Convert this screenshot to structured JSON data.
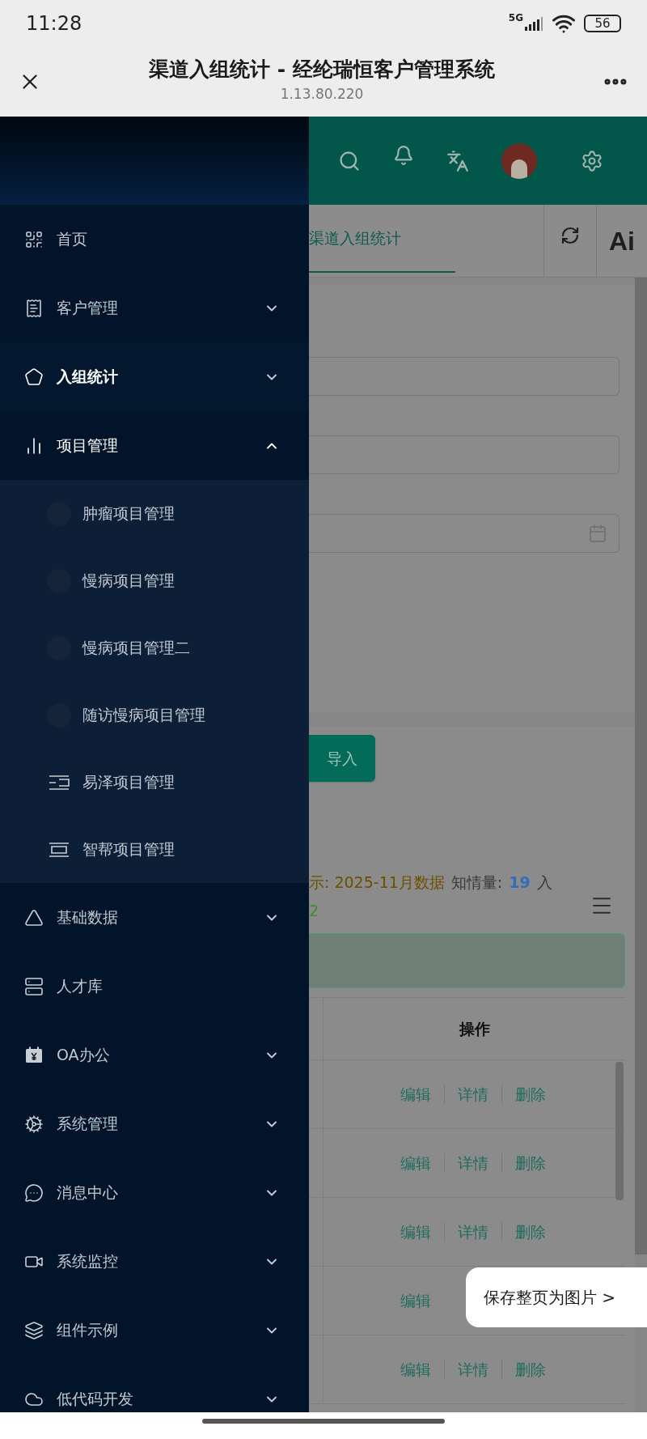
{
  "status_bar": {
    "time": "11:28",
    "network": "5G",
    "battery": "56"
  },
  "title_bar": {
    "title": "渠道入组统计 - 经纶瑞恒客户管理系统",
    "url": "1.13.80.220"
  },
  "sidebar": {
    "items": [
      {
        "label": "首页",
        "kind": "link",
        "selected": false
      },
      {
        "label": "客户管理",
        "kind": "group",
        "selected": false,
        "expanded": false
      },
      {
        "label": "入组统计",
        "kind": "group",
        "selected": true,
        "expanded": false
      },
      {
        "label": "项目管理",
        "kind": "group",
        "selected": false,
        "expanded": true,
        "children": [
          {
            "label": "肿瘤项目管理",
            "selected": false
          },
          {
            "label": "慢病项目管理",
            "selected": false
          },
          {
            "label": "慢病项目管理二",
            "selected": false
          },
          {
            "label": "随访慢病项目管理",
            "selected": false
          },
          {
            "label": "易泽项目管理",
            "selected": false
          },
          {
            "label": "智帮项目管理",
            "selected": false
          }
        ]
      },
      {
        "label": "基础数据",
        "kind": "group",
        "selected": false,
        "expanded": false
      },
      {
        "label": "人才库",
        "kind": "link",
        "selected": false
      },
      {
        "label": "OA办公",
        "kind": "group",
        "selected": false,
        "expanded": false
      },
      {
        "label": "系统管理",
        "kind": "group",
        "selected": false,
        "expanded": false
      },
      {
        "label": "消息中心",
        "kind": "group",
        "selected": false,
        "expanded": false
      },
      {
        "label": "系统监控",
        "kind": "group",
        "selected": false,
        "expanded": false
      },
      {
        "label": "组件示例",
        "kind": "group",
        "selected": false,
        "expanded": false
      },
      {
        "label": "低代码开发",
        "kind": "group",
        "selected": false,
        "expanded": false
      }
    ]
  },
  "tabs": [
    {
      "label": "渠道入组统计",
      "selected": true
    }
  ],
  "ai_button": "Ai",
  "filter_fields": [
    {
      "kind": "text"
    },
    {
      "kind": "text"
    },
    {
      "kind": "date"
    }
  ],
  "import_button": "导入",
  "summary": {
    "line_1": [
      {
        "text": "示: 2025-11月数据",
        "color": "#6e4f00"
      },
      {
        "text": "知情量:",
        "color": "#3a3a3a"
      },
      {
        "text": "19",
        "color": "#2f6fb8"
      },
      {
        "text": "入",
        "color": "#3a3a3a"
      }
    ],
    "line_2": [
      {
        "text": "2",
        "color": "#3f8a2a"
      }
    ]
  },
  "table": {
    "columns": [
      "操作"
    ],
    "rows": [
      {
        "actions": [
          "编辑",
          "详情",
          "删除"
        ]
      },
      {
        "actions": [
          "编辑",
          "详情",
          "删除"
        ]
      },
      {
        "actions": [
          "编辑",
          "详情",
          "删除"
        ]
      },
      {
        "actions": [
          "编辑"
        ]
      },
      {
        "actions": [
          "编辑",
          "详情",
          "删除"
        ]
      }
    ]
  },
  "save_popup": "保存整页为图片 >"
}
